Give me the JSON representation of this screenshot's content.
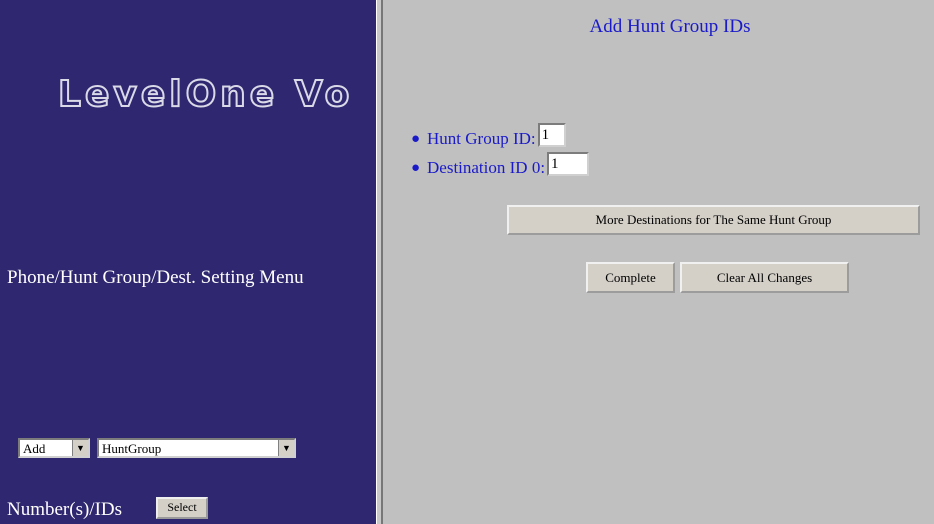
{
  "left_frame": {
    "logo_text": "LevelOne Vo",
    "menu_title": "Phone/Hunt Group/Dest. Setting Menu",
    "action_select": {
      "value": "Add"
    },
    "type_select": {
      "value": "HuntGroup"
    },
    "numbers_label": "Number(s)/IDs",
    "select_button_label": "Select"
  },
  "right_frame": {
    "title": "Add Hunt Group IDs",
    "fields": [
      {
        "label": "Hunt Group ID:",
        "value": "1"
      },
      {
        "label": "Destination ID 0:",
        "value": "1"
      }
    ],
    "more_destinations_label": "More Destinations for The Same Hunt Group",
    "complete_label": "Complete",
    "clear_label": "Clear All Changes"
  },
  "colors": {
    "left_background": "#2f2870",
    "right_background": "#c0c0c0",
    "link_blue": "#1a1ac8"
  }
}
